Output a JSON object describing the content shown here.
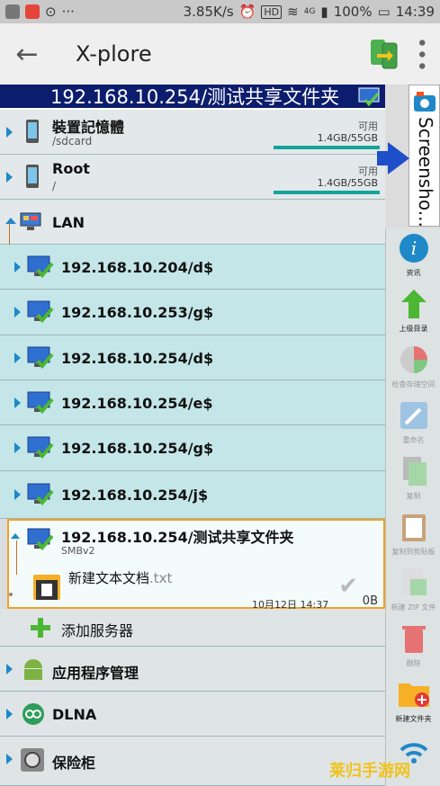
{
  "status": {
    "speed": "3.85K/s",
    "hd": "HD",
    "net": "4G",
    "battery": "100%",
    "time": "14:39"
  },
  "toolbar": {
    "title": "X-plore"
  },
  "path": "192.168.10.254/测试共享文件夹",
  "volumes": [
    {
      "name": "裝置記憶體",
      "path": "/sdcard",
      "avail_label": "可用",
      "size": "1.4GB/55GB"
    },
    {
      "name": "Root",
      "path": "/",
      "avail_label": "可用",
      "size": "1.4GB/55GB"
    }
  ],
  "lan": {
    "label": "LAN"
  },
  "shares": [
    "192.168.10.204/d$",
    "192.168.10.253/g$",
    "192.168.10.254/d$",
    "192.168.10.254/e$",
    "192.168.10.254/g$",
    "192.168.10.254/j$"
  ],
  "selected_share": {
    "name": "192.168.10.254/测试共享文件夹",
    "protocol": "SMBv2"
  },
  "file": {
    "name": "新建文本文档",
    "ext": ".txt",
    "date": "10月12日 14:37",
    "size": "0B"
  },
  "add_server": "添加服务器",
  "bottom_items": [
    "应用程序管理",
    "DLNA",
    "保险柜"
  ],
  "screenshot_tab": "Screensho...",
  "sidebar": {
    "info": "资讯",
    "up": "上级目录",
    "storage": "检查存储空间",
    "rename": "重命名",
    "copy": "复制",
    "copy_clip": "复制到剪贴板",
    "zip": "新建 ZIP 文件",
    "delete": "删除",
    "new_folder": "新建文件夹"
  },
  "watermark": "莱归手游网",
  "colors": {
    "path_bg": "#0c1d6e",
    "accent": "#1e88c8",
    "selection_border": "#f1a226",
    "bar": "#16a39b"
  }
}
